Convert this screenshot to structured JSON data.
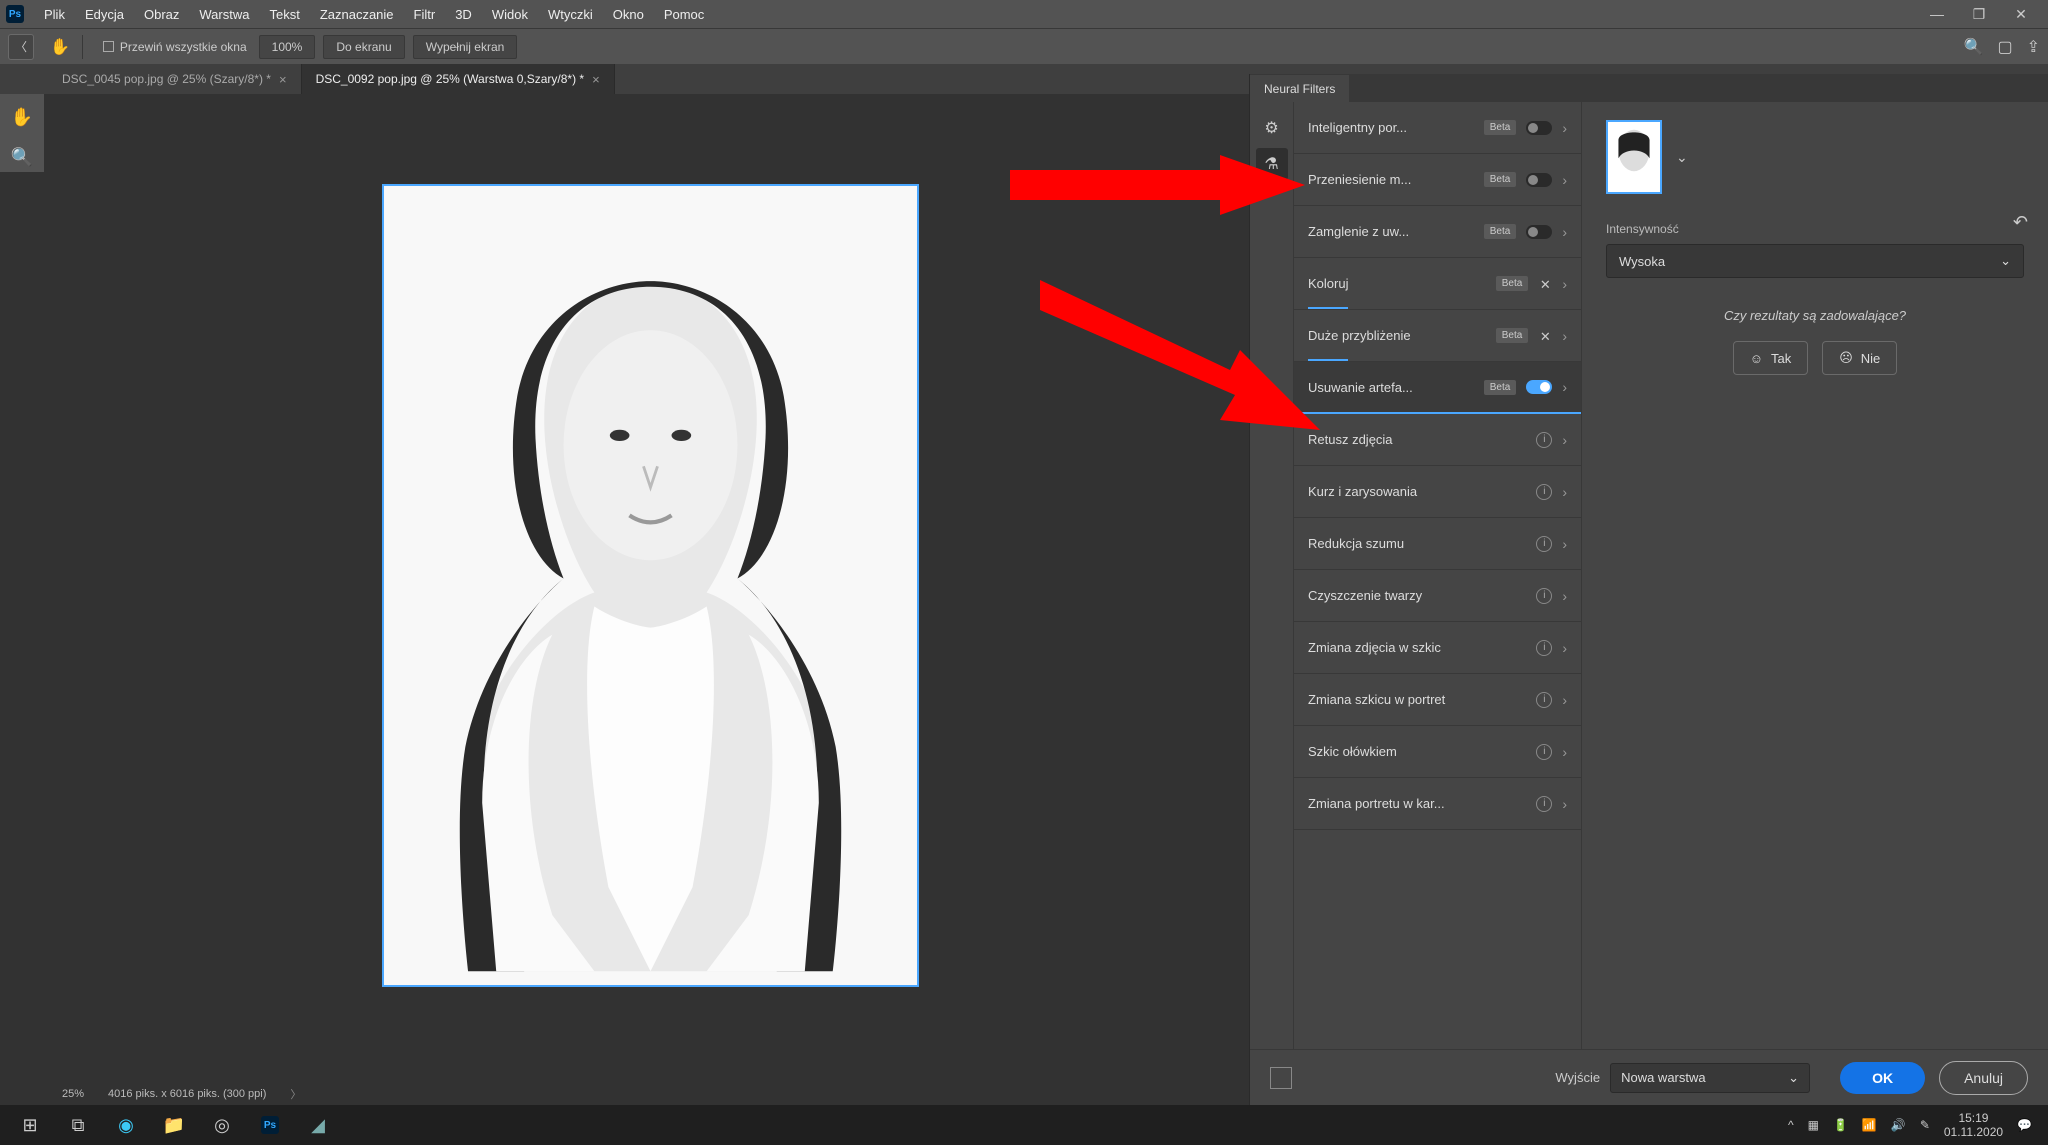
{
  "menu": {
    "items": [
      "Plik",
      "Edycja",
      "Obraz",
      "Warstwa",
      "Tekst",
      "Zaznaczanie",
      "Filtr",
      "3D",
      "Widok",
      "Wtyczki",
      "Okno",
      "Pomoc"
    ]
  },
  "options": {
    "scroll_all": "Przewiń wszystkie okna",
    "zoom": "100%",
    "fit_screen": "Do ekranu",
    "fill_screen": "Wypełnij ekran"
  },
  "tabs": [
    {
      "label": "DSC_0045 pop.jpg @ 25% (Szary/8*) *"
    },
    {
      "label": "DSC_0092 pop.jpg @ 25% (Warstwa 0,Szary/8*) *"
    }
  ],
  "status": {
    "zoom": "25%",
    "dims": "4016 piks. x 6016 piks. (300 ppi)"
  },
  "neural": {
    "title": "Neural Filters",
    "filters": [
      {
        "name": "Inteligentny por...",
        "beta": true,
        "control": "toggle-off"
      },
      {
        "name": "Przeniesienie m...",
        "beta": true,
        "control": "toggle-off"
      },
      {
        "name": "Zamglenie z uw...",
        "beta": true,
        "control": "toggle-off"
      },
      {
        "name": "Koloruj",
        "beta": true,
        "control": "x",
        "progress": true
      },
      {
        "name": "Duże przybliżenie",
        "beta": true,
        "control": "x",
        "progress": true
      },
      {
        "name": "Usuwanie artefa...",
        "beta": true,
        "control": "toggle-on",
        "selected": true
      },
      {
        "name": "Retusz zdjęcia",
        "beta": false,
        "control": "info"
      },
      {
        "name": "Kurz i zarysowania",
        "beta": false,
        "control": "info"
      },
      {
        "name": "Redukcja szumu",
        "beta": false,
        "control": "info"
      },
      {
        "name": "Czyszczenie twarzy",
        "beta": false,
        "control": "info"
      },
      {
        "name": "Zmiana zdjęcia w szkic",
        "beta": false,
        "control": "info"
      },
      {
        "name": "Zmiana szkicu w portret",
        "beta": false,
        "control": "info"
      },
      {
        "name": "Szkic ołówkiem",
        "beta": false,
        "control": "info"
      },
      {
        "name": "Zmiana portretu w kar...",
        "beta": false,
        "control": "info"
      }
    ],
    "detail": {
      "intensity_label": "Intensywność",
      "intensity_value": "Wysoka",
      "satisfy": "Czy rezultaty są zadowalające?",
      "yes": "Tak",
      "no": "Nie"
    },
    "footer": {
      "output_label": "Wyjście",
      "output_value": "Nowa warstwa",
      "ok": "OK",
      "cancel": "Anuluj"
    }
  },
  "taskbar": {
    "time": "15:19",
    "date": "01.11.2020"
  }
}
